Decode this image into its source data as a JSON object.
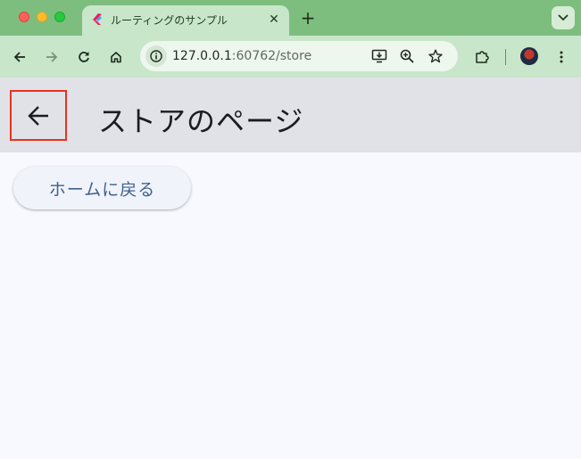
{
  "browser": {
    "tab": {
      "title": "ルーティングのサンプル",
      "close_symbol": "✕",
      "favicon": "flutter-logo-icon"
    },
    "new_tab_symbol": "+",
    "tab_search_icon": "chevron-down-icon",
    "toolbar": {
      "back_icon": "arrow-left-icon",
      "forward_icon": "arrow-right-icon",
      "reload_icon": "reload-icon",
      "home_icon": "home-icon",
      "url_host": "127.0.0.1",
      "url_path": ":60762/store",
      "site_info_icon": "info-icon",
      "install_icon": "install-app-icon",
      "zoom_icon": "zoom-icon",
      "bookmark_icon": "star-icon",
      "extensions_icon": "puzzle-icon",
      "menu_icon": "kebab-menu-icon"
    },
    "colors": {
      "frame": "#7dbe7e",
      "toolbar": "#c8e6c9"
    }
  },
  "app": {
    "appbar": {
      "title": "ストアのページ",
      "back_icon": "arrow-back-icon",
      "background": "#e1e2e8"
    },
    "home_button": {
      "label": "ホームに戻る",
      "text_color": "#3d6290"
    },
    "background": "#f8f9ff"
  }
}
